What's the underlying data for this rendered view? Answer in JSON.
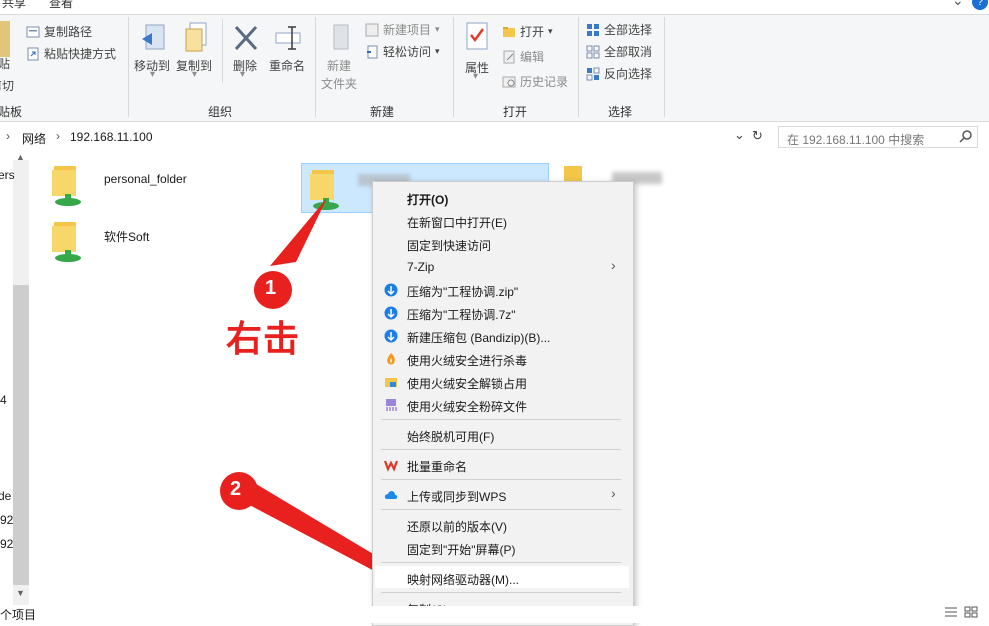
{
  "tabs": [
    "共享",
    "查看"
  ],
  "ribbon": {
    "clipboard": {
      "copy_path": "复制路径",
      "paste_shortcut": "粘贴快捷方式",
      "paste_partial": "贴",
      "cut_partial": "剪切",
      "group_partial": "贴板"
    },
    "organize": {
      "move_to": "移动到",
      "copy_to": "复制到",
      "delete": "删除",
      "rename": "重命名",
      "group": "组织"
    },
    "new": {
      "new_folder_line1": "新建",
      "new_folder_line2": "文件夹",
      "new_item": "新建项目",
      "easy_access": "轻松访问",
      "group": "新建"
    },
    "open": {
      "properties": "属性",
      "open": "打开",
      "edit": "编辑",
      "history": "历史记录",
      "group": "打开"
    },
    "select": {
      "select_all": "全部选择",
      "select_none": "全部取消",
      "invert": "反向选择",
      "group": "选择"
    }
  },
  "address": {
    "crumb_network": "网络",
    "crumb_host": "192.168.11.100",
    "search_placeholder": "在 192.168.11.100 中搜索"
  },
  "nav_partial": [
    "ers",
    "4",
    "de",
    "92",
    "92"
  ],
  "files": [
    {
      "name": "personal_folder"
    },
    {
      "name": "软件Soft"
    }
  ],
  "annotations": {
    "step1": "1",
    "step1_label": "右击",
    "step2": "2"
  },
  "context_menu": {
    "items": [
      {
        "label": "打开(O)",
        "bold": true
      },
      {
        "label": "在新窗口中打开(E)"
      },
      {
        "label": "固定到快速访问"
      },
      {
        "label": "7-Zip",
        "submenu": true
      },
      {
        "label": "压缩为\"工程协调.zip\"",
        "icon": "bandizip-icon"
      },
      {
        "label": "压缩为\"工程协调.7z\"",
        "icon": "bandizip-icon"
      },
      {
        "label": "新建压缩包 (Bandizip)(B)...",
        "icon": "bandizip-icon"
      },
      {
        "label": "使用火绒安全进行杀毒",
        "icon": "huorong-icon"
      },
      {
        "label": "使用火绒安全解锁占用",
        "icon": "unlock-folder-icon"
      },
      {
        "label": "使用火绒安全粉碎文件",
        "icon": "shredder-icon"
      },
      {
        "label": "始终脱机可用(F)"
      },
      {
        "label": "批量重命名",
        "icon": "wps-icon"
      },
      {
        "label": "上传或同步到WPS",
        "icon": "cloud-icon",
        "submenu": true
      },
      {
        "label": "还原以前的版本(V)"
      },
      {
        "label": "固定到\"开始\"屏幕(P)"
      },
      {
        "label": "映射网络驱动器(M)..."
      },
      {
        "label": "复制(C)"
      }
    ]
  },
  "status_bar": {
    "items_partial": "个项目"
  },
  "colors": {
    "accent": "#e02020",
    "selection": "#cce8ff",
    "folder": "#f3c64a"
  }
}
